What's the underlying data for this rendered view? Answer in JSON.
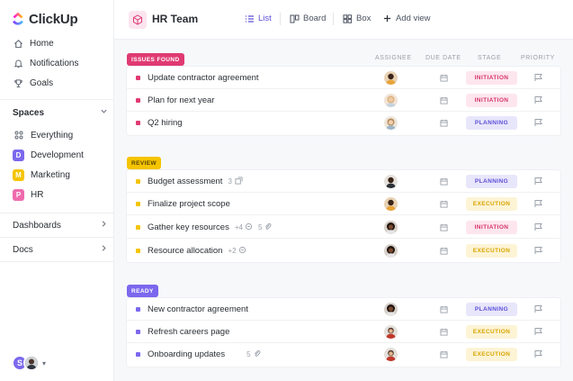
{
  "app": {
    "name": "ClickUp"
  },
  "sidebar": {
    "nav": [
      {
        "label": "Home",
        "icon": "home-icon"
      },
      {
        "label": "Notifications",
        "icon": "bell-icon"
      },
      {
        "label": "Goals",
        "icon": "trophy-icon"
      }
    ],
    "spaces_label": "Spaces",
    "spaces": [
      {
        "label": "Everything",
        "badge": "",
        "color": ""
      },
      {
        "label": "Development",
        "badge": "D",
        "color": "#7b68ee"
      },
      {
        "label": "Marketing",
        "badge": "M",
        "color": "#f5c400"
      },
      {
        "label": "HR",
        "badge": "P",
        "color": "#f06bad"
      }
    ],
    "dashboards_label": "Dashboards",
    "docs_label": "Docs",
    "user_initial": "S"
  },
  "header": {
    "title": "HR Team",
    "views": [
      {
        "label": "List",
        "icon": "list-icon",
        "active": true
      },
      {
        "label": "Board",
        "icon": "board-icon",
        "active": false
      },
      {
        "label": "Box",
        "icon": "box-icon",
        "active": false
      },
      {
        "label": "Add view",
        "icon": "plus-icon",
        "active": false
      }
    ]
  },
  "columns": {
    "assignee": "ASSIGNEE",
    "due_date": "DUE DATE",
    "stage": "STAGE",
    "priority": "PRIORITY"
  },
  "colors": {
    "issues": "#e03a72",
    "review": "#f5c400",
    "ready": "#7b68ee"
  },
  "groups": [
    {
      "label": "ISSUES FOUND",
      "tasks": [
        {
          "name": "Update contractor agreement",
          "meta": "",
          "stage": "INITIATION",
          "stage_class": "initiation"
        },
        {
          "name": "Plan for next year",
          "meta": "",
          "stage": "INITIATION",
          "stage_class": "initiation"
        },
        {
          "name": "Q2 hiring",
          "meta": "",
          "stage": "PLANNING",
          "stage_class": "planning"
        }
      ]
    },
    {
      "label": "REVIEW",
      "tasks": [
        {
          "name": "Budget assessment",
          "meta": "3",
          "stage": "PLANNING",
          "stage_class": "planning"
        },
        {
          "name": "Finalize project scope",
          "meta": "",
          "stage": "EXECUTION",
          "stage_class": "execution"
        },
        {
          "name": "Gather key resources",
          "meta": "+4",
          "meta2": "5",
          "stage": "INITIATION",
          "stage_class": "initiation"
        },
        {
          "name": "Resource allocation",
          "meta": "+2",
          "stage": "EXECUTION",
          "stage_class": "execution"
        }
      ]
    },
    {
      "label": "READY",
      "tasks": [
        {
          "name": "New contractor agreement",
          "meta": "",
          "stage": "PLANNING",
          "stage_class": "planning"
        },
        {
          "name": "Refresh careers page",
          "meta": "",
          "stage": "EXECUTION",
          "stage_class": "execution"
        },
        {
          "name": "Onboarding updates",
          "meta": "5",
          "stage": "EXECUTION",
          "stage_class": "execution"
        }
      ]
    }
  ]
}
